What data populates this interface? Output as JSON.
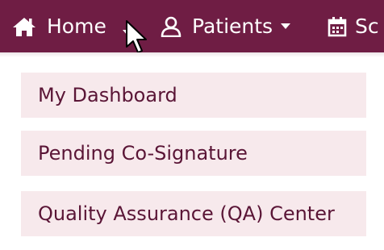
{
  "navbar": {
    "background": "#6f1d44",
    "items": [
      {
        "label": "Home",
        "icon": "home-icon"
      },
      {
        "label": "Patients",
        "icon": "user-icon",
        "has_dropdown": true
      },
      {
        "label": "Sc",
        "icon": "calendar-icon"
      }
    ]
  },
  "dropdown": {
    "item_background": "#f7e9ec",
    "text_color": "#5a1536",
    "items": [
      {
        "label": "My Dashboard"
      },
      {
        "label": "Pending Co-Signature"
      },
      {
        "label": "Quality Assurance (QA) Center"
      }
    ]
  }
}
